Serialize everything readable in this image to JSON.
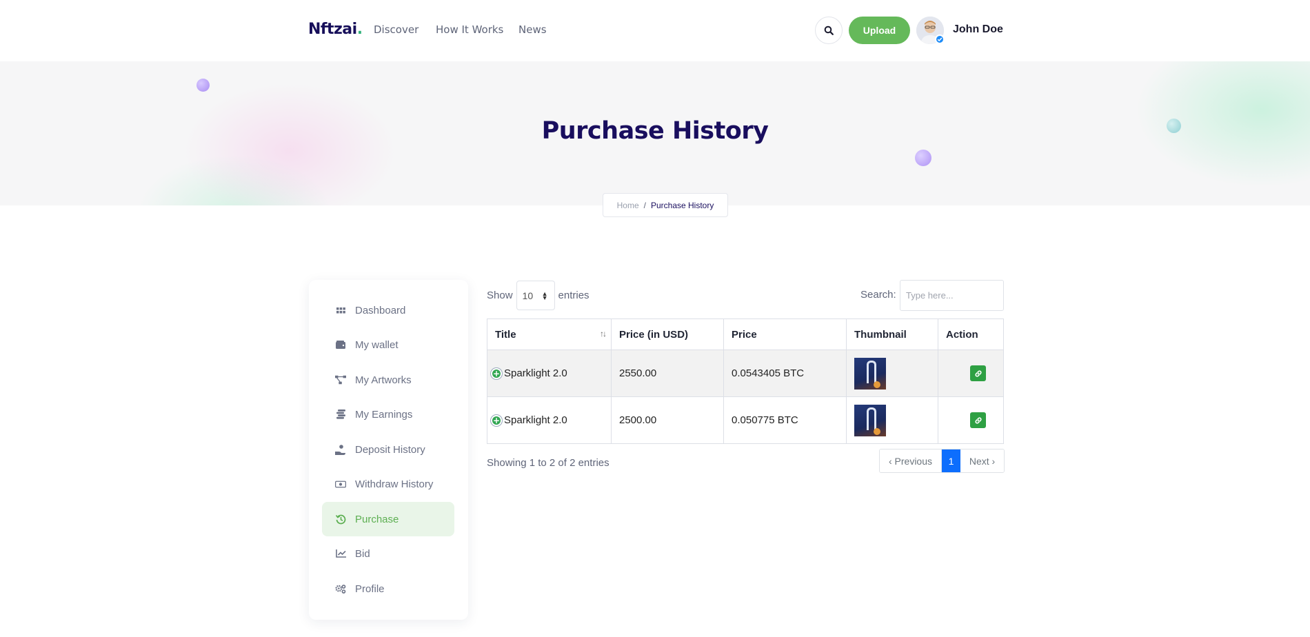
{
  "brand": {
    "name": "Nftzai",
    "dot": "."
  },
  "nav": {
    "items": [
      "Discover",
      "How It Works",
      "News"
    ]
  },
  "header": {
    "upload_label": "Upload",
    "user_name": "John Doe"
  },
  "hero": {
    "title": "Purchase History"
  },
  "breadcrumb": {
    "home": "Home",
    "separator": "/",
    "current": "Purchase History"
  },
  "sidebar": {
    "items": [
      {
        "label": "Dashboard",
        "icon": "grid-icon"
      },
      {
        "label": "My wallet",
        "icon": "wallet-icon"
      },
      {
        "label": "My Artworks",
        "icon": "network-icon"
      },
      {
        "label": "My Earnings",
        "icon": "coins-icon"
      },
      {
        "label": "Deposit History",
        "icon": "hand-coin-icon"
      },
      {
        "label": "Withdraw History",
        "icon": "money-bill-icon"
      },
      {
        "label": "Purchase",
        "icon": "history-icon",
        "active": true
      },
      {
        "label": "Bid",
        "icon": "chart-line-icon"
      },
      {
        "label": "Profile",
        "icon": "gears-icon"
      }
    ]
  },
  "table_controls": {
    "show_label": "Show",
    "entries_value": "10",
    "entries_label": "entries",
    "search_label": "Search:",
    "search_placeholder": "Type here..."
  },
  "table": {
    "headers": [
      "Title",
      "Price (in USD)",
      "Price",
      "Thumbnail",
      "Action"
    ],
    "rows": [
      {
        "title": "Sparklight 2.0",
        "price_usd": "2550.00",
        "price": "0.0543405 BTC"
      },
      {
        "title": "Sparklight 2.0",
        "price_usd": "2500.00",
        "price": "0.050775 BTC"
      }
    ]
  },
  "pagination": {
    "info": "Showing 1 to 2 of 2 entries",
    "previous": "‹ Previous",
    "current_page": "1",
    "next": "Next ›"
  },
  "colors": {
    "accent_green": "#65b95a",
    "title_navy": "#190e5e",
    "page_blue": "#0d6efd"
  }
}
